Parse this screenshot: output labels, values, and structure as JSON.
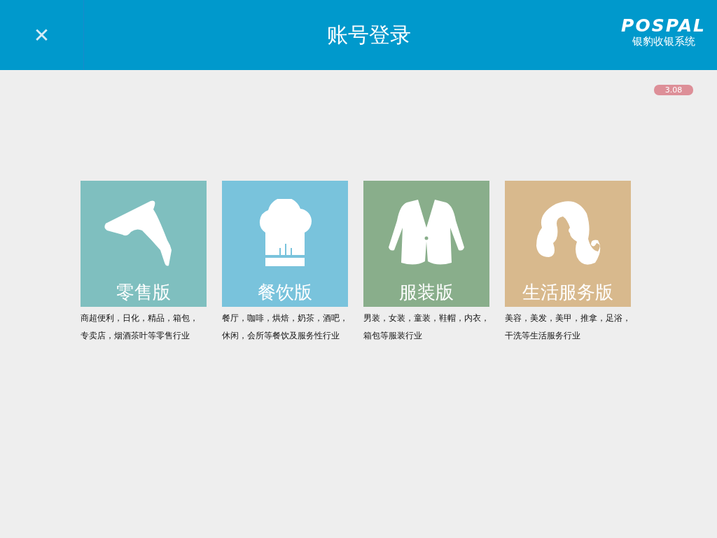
{
  "header": {
    "close": "✕",
    "title": "账号登录",
    "logo": {
      "brand": "POSPAL",
      "subtitle": "银豹收银系统"
    }
  },
  "version": "3.08",
  "editions": [
    {
      "kind": "retail",
      "title": "零售版",
      "color": "#7fbfbf",
      "description_lines": [
        "商超便利，日化，精品，箱包，",
        "专卖店，烟酒茶叶等零售行业"
      ]
    },
    {
      "kind": "restaurant",
      "title": "餐饮版",
      "color": "#79c3dc",
      "description_lines": [
        "餐厅，咖啡，烘焙，奶茶，酒吧，",
        "休闲，会所等餐饮及服务性行业"
      ]
    },
    {
      "kind": "apparel",
      "title": "服装版",
      "color": "#89ae8b",
      "description_lines": [
        "男装，女装，童装，鞋帽，内衣，",
        "箱包等服装行业"
      ]
    },
    {
      "kind": "services",
      "title": "生活服务版",
      "color": "#d8b98d",
      "description_lines": [
        "美容，美发，美甲，推拿，足浴，",
        "干洗等生活服务行业"
      ]
    }
  ]
}
